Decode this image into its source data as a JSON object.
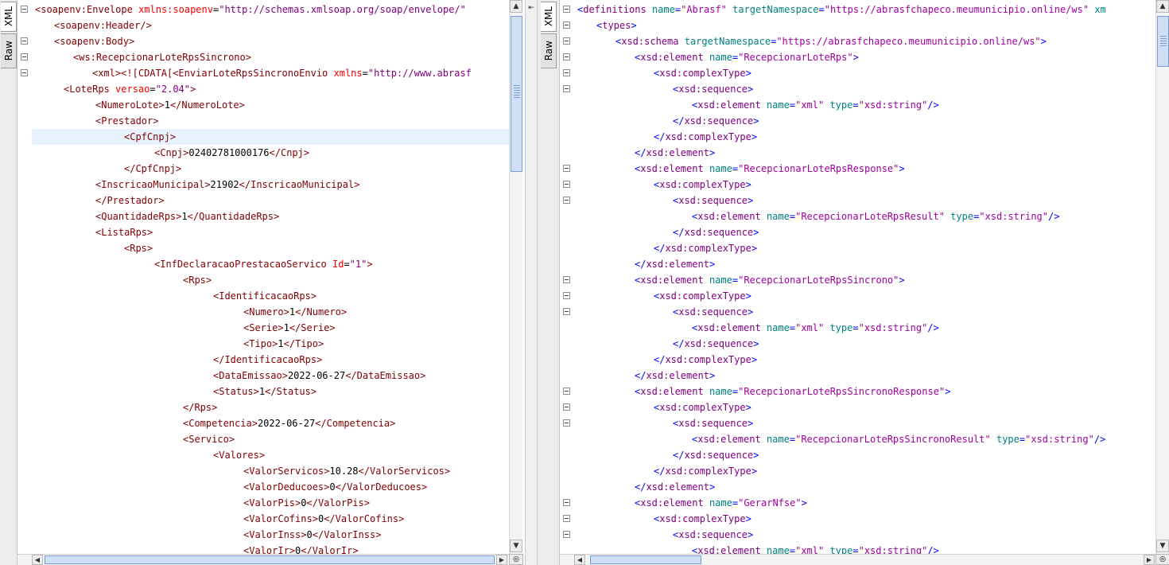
{
  "left": {
    "tabs": [
      "XML",
      "Raw"
    ],
    "lines": [
      "<soapenv:Envelope xmlns:soapenv=\"http://schemas.xmlsoap.org/soap/envelope/\"",
      "<soapenv:Header/>",
      "<soapenv:Body>",
      "<ws:RecepcionarLoteRpsSincrono>",
      "<xml><![CDATA[<EnviarLoteRpsSincronoEnvio xmlns=\"http://www.abrasf",
      "<LoteRps versao=\"2.04\">",
      "<NumeroLote>1</NumeroLote>",
      "<Prestador>",
      "<CpfCnpj>",
      "<Cnpj>02402781000176</Cnpj>",
      "</CpfCnpj>",
      "<InscricaoMunicipal>21902</InscricaoMunicipal>",
      "</Prestador>",
      "<QuantidadeRps>1</QuantidadeRps>",
      "<ListaRps>",
      "<Rps>",
      "<InfDeclaracaoPrestacaoServico Id=\"1\">",
      "<Rps>",
      "<IdentificacaoRps>",
      "<Numero>1</Numero>",
      "<Serie>1</Serie>",
      "<Tipo>1</Tipo>",
      "</IdentificacaoRps>",
      "<DataEmissao>2022-06-27</DataEmissao>",
      "<Status>1</Status>",
      "</Rps>",
      "<Competencia>2022-06-27</Competencia>",
      "<Servico>",
      "<Valores>",
      "<ValorServicos>10.28</ValorServicos>",
      "<ValorDeducoes>0</ValorDeducoes>",
      "<ValorPis>0</ValorPis>",
      "<ValorCofins>0</ValorCofins>",
      "<ValorInss>0</ValorInss>",
      "<ValorIr>0</ValorIr>"
    ]
  },
  "right": {
    "tabs": [
      "XML",
      "Raw"
    ],
    "lines": [
      "<definitions name=\"Abrasf\" targetNamespace=\"https://abrasfchapeco.meumunicipio.online/ws\" xm",
      "<types>",
      "<xsd:schema targetNamespace=\"https://abrasfchapeco.meumunicipio.online/ws\">",
      "<xsd:element name=\"RecepcionarLoteRps\">",
      "<xsd:complexType>",
      "<xsd:sequence>",
      "<xsd:element name=\"xml\" type=\"xsd:string\"/>",
      "</xsd:sequence>",
      "</xsd:complexType>",
      "</xsd:element>",
      "<xsd:element name=\"RecepcionarLoteRpsResponse\">",
      "<xsd:complexType>",
      "<xsd:sequence>",
      "<xsd:element name=\"RecepcionarLoteRpsResult\" type=\"xsd:string\"/>",
      "</xsd:sequence>",
      "</xsd:complexType>",
      "</xsd:element>",
      "<xsd:element name=\"RecepcionarLoteRpsSincrono\">",
      "<xsd:complexType>",
      "<xsd:sequence>",
      "<xsd:element name=\"xml\" type=\"xsd:string\"/>",
      "</xsd:sequence>",
      "</xsd:complexType>",
      "</xsd:element>",
      "<xsd:element name=\"RecepcionarLoteRpsSincronoResponse\">",
      "<xsd:complexType>",
      "<xsd:sequence>",
      "<xsd:element name=\"RecepcionarLoteRpsSincronoResult\" type=\"xsd:string\"/>",
      "</xsd:sequence>",
      "</xsd:complexType>",
      "</xsd:element>",
      "<xsd:element name=\"GerarNfse\">",
      "<xsd:complexType>",
      "<xsd:sequence>",
      "<xsd:element name=\"xml\" type=\"xsd:string\"/>"
    ]
  },
  "scroll_labels": {
    "up": "▲",
    "down": "▼",
    "left": "◀",
    "right": "▶"
  }
}
